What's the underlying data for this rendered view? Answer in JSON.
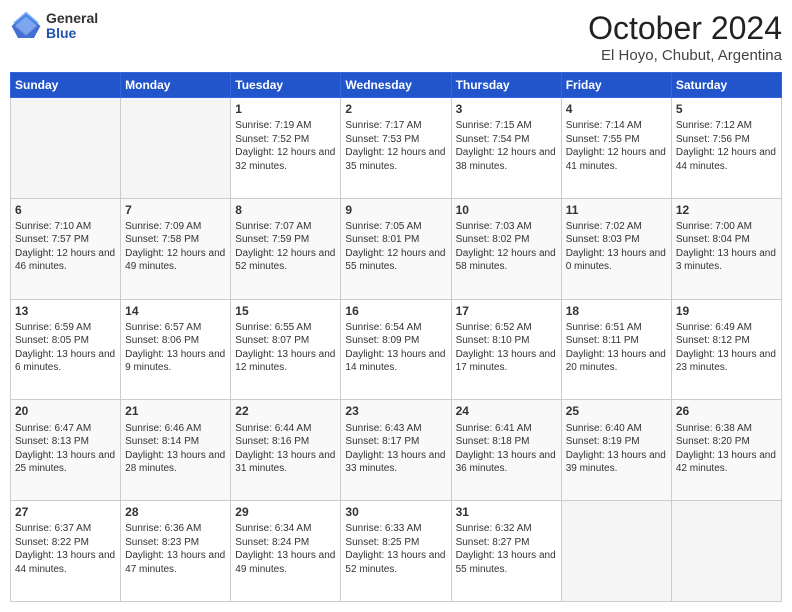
{
  "logo": {
    "general": "General",
    "blue": "Blue"
  },
  "header": {
    "month": "October 2024",
    "location": "El Hoyo, Chubut, Argentina"
  },
  "days_of_week": [
    "Sunday",
    "Monday",
    "Tuesday",
    "Wednesday",
    "Thursday",
    "Friday",
    "Saturday"
  ],
  "weeks": [
    [
      {
        "day": "",
        "info": ""
      },
      {
        "day": "",
        "info": ""
      },
      {
        "day": "1",
        "info": "Sunrise: 7:19 AM\nSunset: 7:52 PM\nDaylight: 12 hours and 32 minutes."
      },
      {
        "day": "2",
        "info": "Sunrise: 7:17 AM\nSunset: 7:53 PM\nDaylight: 12 hours and 35 minutes."
      },
      {
        "day": "3",
        "info": "Sunrise: 7:15 AM\nSunset: 7:54 PM\nDaylight: 12 hours and 38 minutes."
      },
      {
        "day": "4",
        "info": "Sunrise: 7:14 AM\nSunset: 7:55 PM\nDaylight: 12 hours and 41 minutes."
      },
      {
        "day": "5",
        "info": "Sunrise: 7:12 AM\nSunset: 7:56 PM\nDaylight: 12 hours and 44 minutes."
      }
    ],
    [
      {
        "day": "6",
        "info": "Sunrise: 7:10 AM\nSunset: 7:57 PM\nDaylight: 12 hours and 46 minutes."
      },
      {
        "day": "7",
        "info": "Sunrise: 7:09 AM\nSunset: 7:58 PM\nDaylight: 12 hours and 49 minutes."
      },
      {
        "day": "8",
        "info": "Sunrise: 7:07 AM\nSunset: 7:59 PM\nDaylight: 12 hours and 52 minutes."
      },
      {
        "day": "9",
        "info": "Sunrise: 7:05 AM\nSunset: 8:01 PM\nDaylight: 12 hours and 55 minutes."
      },
      {
        "day": "10",
        "info": "Sunrise: 7:03 AM\nSunset: 8:02 PM\nDaylight: 12 hours and 58 minutes."
      },
      {
        "day": "11",
        "info": "Sunrise: 7:02 AM\nSunset: 8:03 PM\nDaylight: 13 hours and 0 minutes."
      },
      {
        "day": "12",
        "info": "Sunrise: 7:00 AM\nSunset: 8:04 PM\nDaylight: 13 hours and 3 minutes."
      }
    ],
    [
      {
        "day": "13",
        "info": "Sunrise: 6:59 AM\nSunset: 8:05 PM\nDaylight: 13 hours and 6 minutes."
      },
      {
        "day": "14",
        "info": "Sunrise: 6:57 AM\nSunset: 8:06 PM\nDaylight: 13 hours and 9 minutes."
      },
      {
        "day": "15",
        "info": "Sunrise: 6:55 AM\nSunset: 8:07 PM\nDaylight: 13 hours and 12 minutes."
      },
      {
        "day": "16",
        "info": "Sunrise: 6:54 AM\nSunset: 8:09 PM\nDaylight: 13 hours and 14 minutes."
      },
      {
        "day": "17",
        "info": "Sunrise: 6:52 AM\nSunset: 8:10 PM\nDaylight: 13 hours and 17 minutes."
      },
      {
        "day": "18",
        "info": "Sunrise: 6:51 AM\nSunset: 8:11 PM\nDaylight: 13 hours and 20 minutes."
      },
      {
        "day": "19",
        "info": "Sunrise: 6:49 AM\nSunset: 8:12 PM\nDaylight: 13 hours and 23 minutes."
      }
    ],
    [
      {
        "day": "20",
        "info": "Sunrise: 6:47 AM\nSunset: 8:13 PM\nDaylight: 13 hours and 25 minutes."
      },
      {
        "day": "21",
        "info": "Sunrise: 6:46 AM\nSunset: 8:14 PM\nDaylight: 13 hours and 28 minutes."
      },
      {
        "day": "22",
        "info": "Sunrise: 6:44 AM\nSunset: 8:16 PM\nDaylight: 13 hours and 31 minutes."
      },
      {
        "day": "23",
        "info": "Sunrise: 6:43 AM\nSunset: 8:17 PM\nDaylight: 13 hours and 33 minutes."
      },
      {
        "day": "24",
        "info": "Sunrise: 6:41 AM\nSunset: 8:18 PM\nDaylight: 13 hours and 36 minutes."
      },
      {
        "day": "25",
        "info": "Sunrise: 6:40 AM\nSunset: 8:19 PM\nDaylight: 13 hours and 39 minutes."
      },
      {
        "day": "26",
        "info": "Sunrise: 6:38 AM\nSunset: 8:20 PM\nDaylight: 13 hours and 42 minutes."
      }
    ],
    [
      {
        "day": "27",
        "info": "Sunrise: 6:37 AM\nSunset: 8:22 PM\nDaylight: 13 hours and 44 minutes."
      },
      {
        "day": "28",
        "info": "Sunrise: 6:36 AM\nSunset: 8:23 PM\nDaylight: 13 hours and 47 minutes."
      },
      {
        "day": "29",
        "info": "Sunrise: 6:34 AM\nSunset: 8:24 PM\nDaylight: 13 hours and 49 minutes."
      },
      {
        "day": "30",
        "info": "Sunrise: 6:33 AM\nSunset: 8:25 PM\nDaylight: 13 hours and 52 minutes."
      },
      {
        "day": "31",
        "info": "Sunrise: 6:32 AM\nSunset: 8:27 PM\nDaylight: 13 hours and 55 minutes."
      },
      {
        "day": "",
        "info": ""
      },
      {
        "day": "",
        "info": ""
      }
    ]
  ]
}
